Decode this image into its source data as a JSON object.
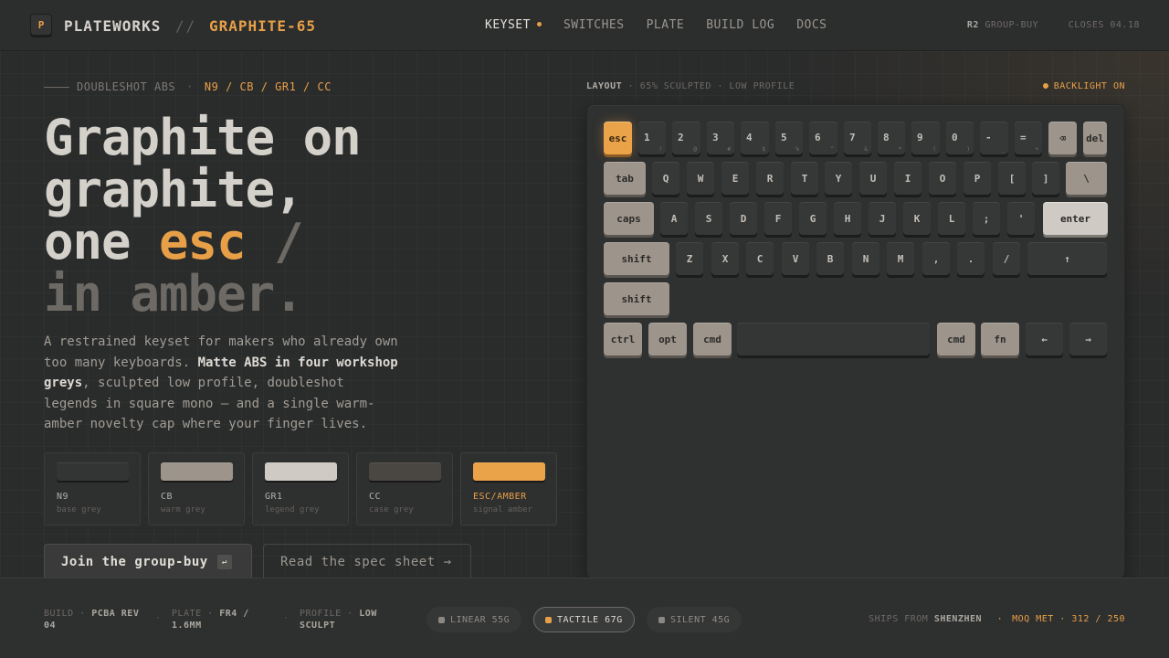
{
  "nav": {
    "logo_letter": "P",
    "brand": "PLATEWORKS",
    "separator": "//",
    "model": "GRAPHITE-65",
    "links": [
      {
        "label": "KEYSET",
        "active": true
      },
      {
        "label": "SWITCHES"
      },
      {
        "label": "PLATE"
      },
      {
        "label": "BUILD LOG"
      },
      {
        "label": "DOCS"
      }
    ],
    "round": "R2",
    "round_label": "GROUP-BUY",
    "closes": "CLOSES 04.18"
  },
  "hero": {
    "eyebrow": "DOUBLESHOT ABS",
    "eyebrow_sep": "·",
    "codes": "N9 / CB / GR1 / CC",
    "headline": {
      "line1": "Graphite on",
      "line2": "graphite,",
      "line3a": "one ",
      "line3b": "esc",
      "line3c": " /",
      "line4": "in amber."
    },
    "desc": {
      "part1": "A restrained keyset for makers who already own too many keyboards. ",
      "bold": "Matte ABS in four workshop greys",
      "part2": ", sculpted low profile, doubleshot legends in square mono — and a single warm-amber novelty cap where your finger lives."
    },
    "swatches": [
      {
        "code": "N9",
        "sub": "base grey",
        "color": "#333434"
      },
      {
        "code": "CB",
        "sub": "warm grey",
        "color": "#9d958c"
      },
      {
        "code": "GR1",
        "sub": "legend grey",
        "color": "#cfcbc4"
      },
      {
        "code": "CC",
        "sub": "case grey",
        "color": "#4a4642"
      },
      {
        "code": "ESC/AMBER",
        "sub": "signal amber",
        "color": "#eba34a"
      }
    ],
    "cta_primary": "Join the group-buy",
    "cta_primary_hint": "↵",
    "cta_secondary": "Read the spec sheet →"
  },
  "keyboard": {
    "layout_label": "LAYOUT",
    "layout_desc": "· 65% SCULPTED · LOW PROFILE",
    "backlight": "BACKLIGHT ON",
    "rows": {
      "r1": [
        {
          "l": "esc",
          "t": "amber"
        },
        {
          "l": "1",
          "s": "!"
        },
        {
          "l": "2",
          "s": "@"
        },
        {
          "l": "3",
          "s": "#"
        },
        {
          "l": "4",
          "s": "$"
        },
        {
          "l": "5",
          "s": "%"
        },
        {
          "l": "6",
          "s": "^"
        },
        {
          "l": "7",
          "s": "&"
        },
        {
          "l": "8",
          "s": "*"
        },
        {
          "l": "9",
          "s": "("
        },
        {
          "l": "0",
          "s": ")"
        },
        {
          "l": "-",
          "s": "_"
        },
        {
          "l": "=",
          "s": "+"
        },
        {
          "l": "⌫",
          "t": "warm"
        },
        {
          "l": "del",
          "t": "warm"
        }
      ],
      "r2": [
        {
          "l": "tab",
          "t": "warm"
        },
        {
          "l": "Q"
        },
        {
          "l": "W"
        },
        {
          "l": "E"
        },
        {
          "l": "R"
        },
        {
          "l": "T"
        },
        {
          "l": "Y"
        },
        {
          "l": "U"
        },
        {
          "l": "I"
        },
        {
          "l": "O"
        },
        {
          "l": "P"
        },
        {
          "l": "["
        },
        {
          "l": "]"
        },
        {
          "l": "\\",
          "t": "warm"
        }
      ],
      "r3": [
        {
          "l": "caps",
          "t": "warm"
        },
        {
          "l": "A"
        },
        {
          "l": "S"
        },
        {
          "l": "D"
        },
        {
          "l": "F"
        },
        {
          "l": "G"
        },
        {
          "l": "H"
        },
        {
          "l": "J"
        },
        {
          "l": "K"
        },
        {
          "l": "L"
        },
        {
          "l": ";"
        },
        {
          "l": "'"
        },
        {
          "l": "enter",
          "t": "legend"
        }
      ],
      "r4": [
        {
          "l": "shift",
          "t": "warm"
        },
        {
          "l": "Z"
        },
        {
          "l": "X"
        },
        {
          "l": "C"
        },
        {
          "l": "V"
        },
        {
          "l": "B"
        },
        {
          "l": "N"
        },
        {
          "l": "M"
        },
        {
          "l": ","
        },
        {
          "l": "."
        },
        {
          "l": "/"
        },
        {
          "l": "↑"
        }
      ],
      "r5": [
        {
          "l": "shift",
          "t": "warm"
        }
      ],
      "r6": [
        {
          "l": "ctrl",
          "t": "warm"
        },
        {
          "l": "opt",
          "t": "warm"
        },
        {
          "l": "cmd",
          "t": "warm"
        },
        {
          "l": "",
          "t": "space"
        },
        {
          "l": "cmd",
          "t": "warm"
        },
        {
          "l": "fn",
          "t": "warm"
        },
        {
          "l": "←"
        },
        {
          "l": "→"
        }
      ]
    }
  },
  "footer": {
    "build_label": "BUILD ·",
    "build_value": "PCBA REV 04",
    "plate_label": "PLATE ·",
    "plate_value": "FR4 / 1.6MM",
    "profile_label": "PROFILE ·",
    "profile_value": "LOW SCULPT",
    "dot": "·",
    "switches": [
      {
        "label": "LINEAR 55G"
      },
      {
        "label": "TACTILE 67G",
        "active": true
      },
      {
        "label": "SILENT 45G"
      }
    ],
    "ships_label": "SHIPS FROM",
    "ships_value": "SHENZHEN",
    "moq": "MOQ MET · 312 / 250"
  }
}
